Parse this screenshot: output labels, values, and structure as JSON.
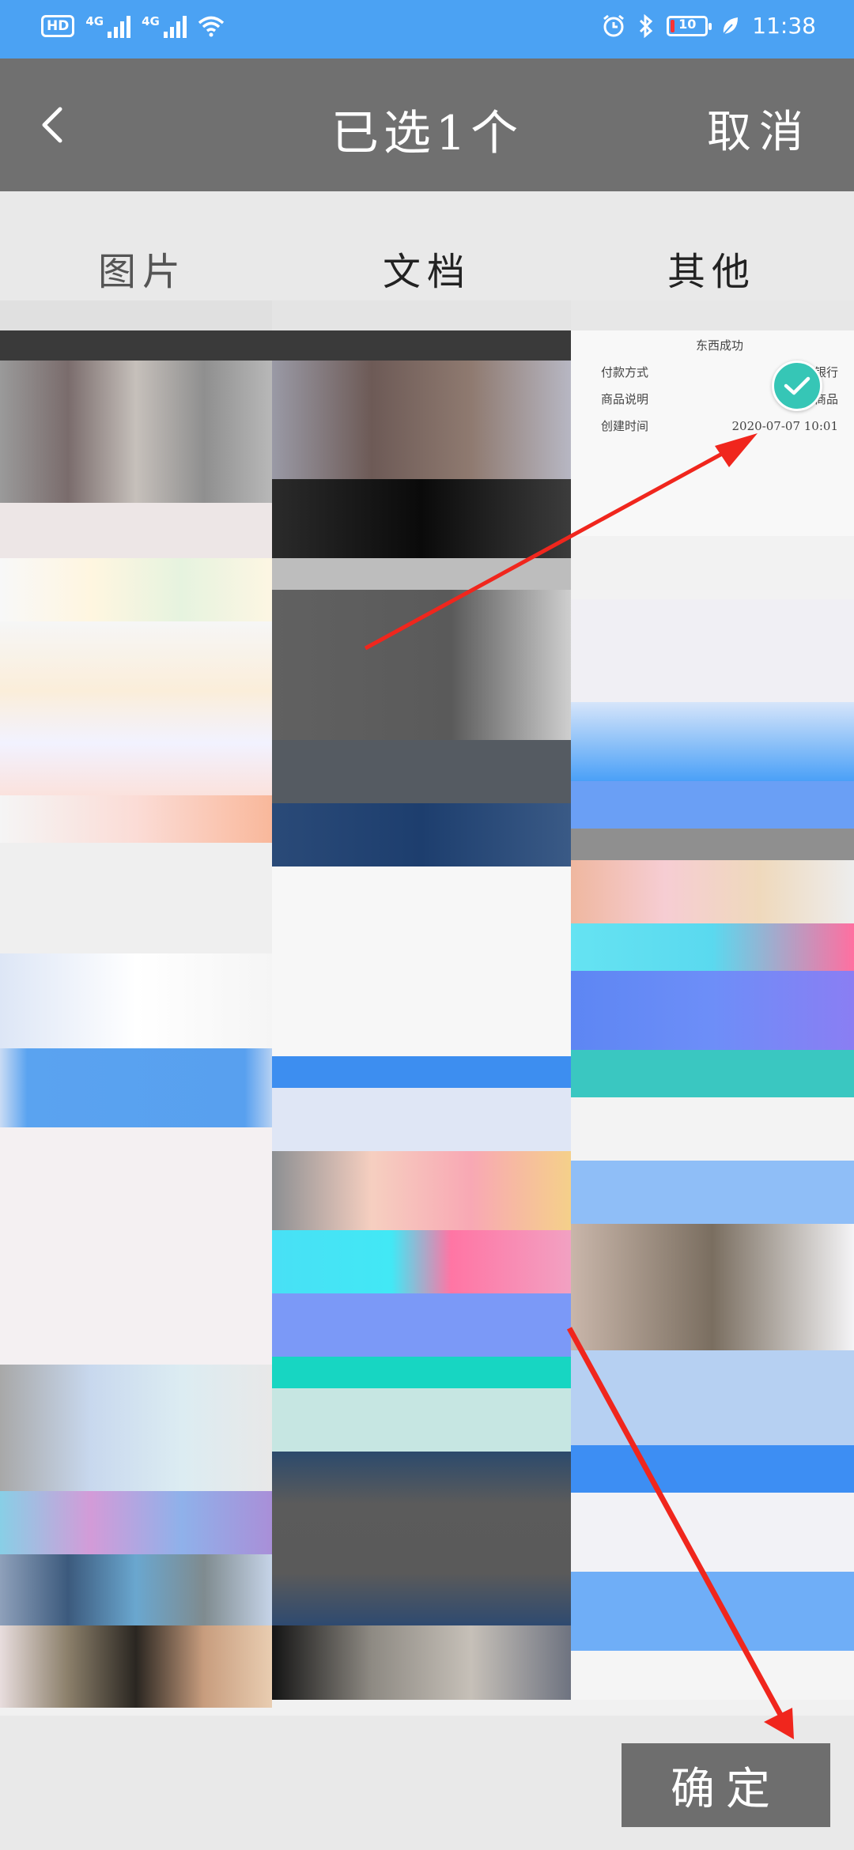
{
  "status_bar": {
    "hd": "HD",
    "network_1": "4G",
    "network_2": "4G",
    "battery_level": "10",
    "battery_fraction": 0.1,
    "time": "11:38"
  },
  "header": {
    "title": "已选1个",
    "cancel_label": "取消"
  },
  "tabs": [
    {
      "label": "图片"
    },
    {
      "label": "文档"
    },
    {
      "label": "其他"
    }
  ],
  "preview_text": {
    "heading": "东西成功",
    "rows": [
      {
        "label": "付款方式",
        "value": "网商银行"
      },
      {
        "label": "商品说明",
        "value": "商品"
      },
      {
        "label": "创建时间",
        "value": "2020-07-07 10:01"
      }
    ]
  },
  "footer": {
    "confirm_label": "确定"
  },
  "colors": {
    "status_bar": "#4ba2f3",
    "title_bar": "#707070",
    "selected_check": "#36c6b6",
    "annotation_arrow": "#f0261d"
  }
}
